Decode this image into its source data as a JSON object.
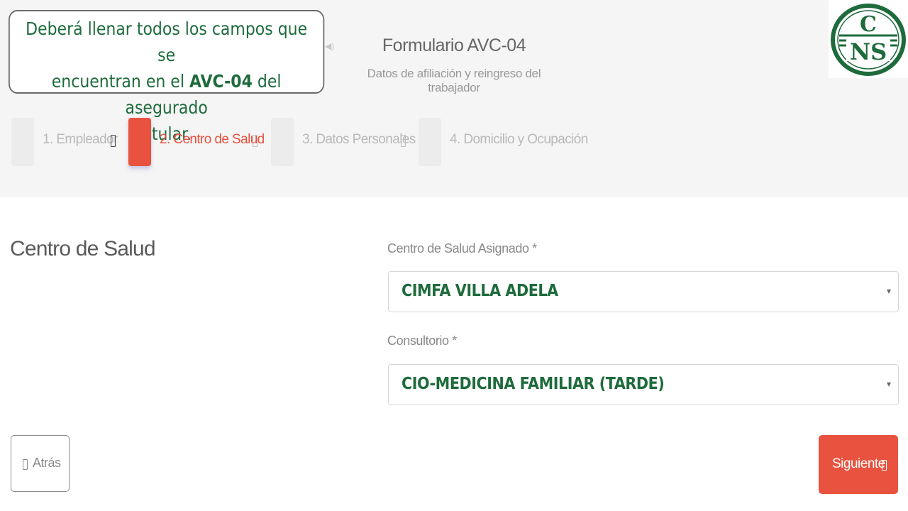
{
  "callout": {
    "line1": "Deberá llenar todos los campos que se",
    "line2_pre": "encuentran en el ",
    "line2_bold": "AVC-04",
    "line2_post": " del asegurado",
    "line3": "titular."
  },
  "form": {
    "title": "Formulario AVC-04",
    "subtitle": "Datos de afiliación y reingreso del trabajador"
  },
  "logo": {
    "top_letter": "C",
    "bottom_letters": "NS",
    "color": "#1e6b3c"
  },
  "stepper": {
    "steps": [
      {
        "label": "1. Empleador",
        "active": false
      },
      {
        "label": "2. Centro de Salud",
        "active": true
      },
      {
        "label": "3. Datos Personales",
        "active": false
      },
      {
        "label": "4. Domicilio y Ocupación",
        "active": false
      }
    ]
  },
  "section": {
    "title": "Centro de Salud",
    "fields": [
      {
        "label": "Centro de Salud Asignado *",
        "value": "CIMFA VILLA ADELA"
      },
      {
        "label": "Consultorio *",
        "value": "CIO-MEDICINA FAMILIAR (TARDE)"
      }
    ]
  },
  "buttons": {
    "back_label": "Atrás",
    "next_label": "Siguiente"
  },
  "colors": {
    "accent": "#e8523f",
    "brand_green": "#1e6b3c"
  },
  "icons": {
    "chevron": "▾",
    "speaker": "◀)"
  }
}
